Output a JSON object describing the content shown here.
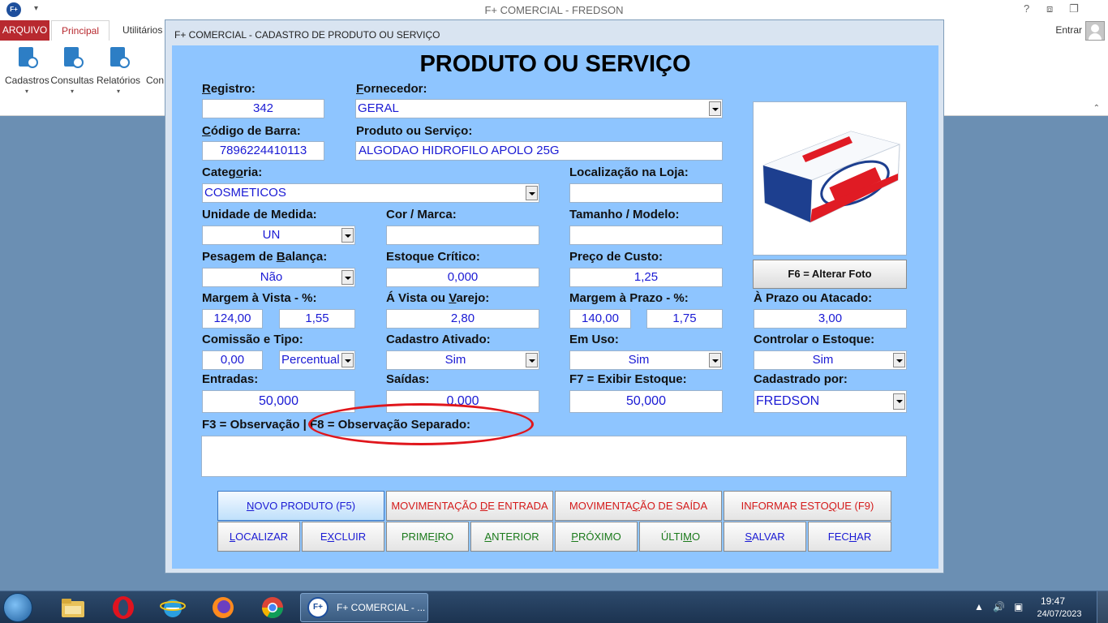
{
  "app": {
    "title": "F+ COMERCIAL - FREDSON",
    "logo": "F+",
    "help": "?",
    "signin": "Entrar"
  },
  "ribbon": {
    "tabs": [
      "ARQUIVO",
      "Principal",
      "Utilitários"
    ],
    "buttons": [
      "Cadastros",
      "Consultas",
      "Relatórios",
      "Con"
    ]
  },
  "dialog": {
    "title": "F+ COMERCIAL - CADASTRO DE PRODUTO OU SERVIÇO",
    "heading": "PRODUTO OU SERVIÇO",
    "photo_button": "F6 = Alterar Foto",
    "observation_label": "F3 = Observação | F8 = Observação Separado:",
    "fields": {
      "registro": {
        "label_u": "R",
        "label_rest": "egistro:",
        "value": "342"
      },
      "fornecedor": {
        "label_u": "F",
        "label_rest": "ornecedor:",
        "value": "GERAL"
      },
      "codigo_barra": {
        "label_u": "C",
        "label_rest": "ódigo de Barra:",
        "value": "7896224410113"
      },
      "produto": {
        "label": "Produto ou Serviço:",
        "value": "ALGODAO HIDROFILO APOLO 25G"
      },
      "categoria": {
        "label_pre": "Categ",
        "label_u": "o",
        "label_post": "ria:",
        "value": "COSMETICOS"
      },
      "localizacao": {
        "label": "Localização na Loja:",
        "value": ""
      },
      "unidade": {
        "label": "Unidade de Medida:",
        "value": "UN"
      },
      "cor_marca": {
        "label": "Cor / Marca:",
        "value": ""
      },
      "tamanho": {
        "label": "Tamanho / Modelo:",
        "value": ""
      },
      "pesagem": {
        "label_pre": "Pesagem de ",
        "label_u": "B",
        "label_post": "alança:",
        "value": "Não"
      },
      "estoque_critico": {
        "label": "Estoque Crítico:",
        "value": "0,000"
      },
      "preco_custo": {
        "label": "Preço de Custo:",
        "value": "1,25"
      },
      "margem_vista": {
        "label": "Margem à Vista - %:",
        "value1": "124,00",
        "value2": "1,55"
      },
      "avista": {
        "label_pre": "Á Vista ou ",
        "label_u": "V",
        "label_post": "arejo:",
        "value": "2,80"
      },
      "margem_prazo": {
        "label": "Margem à Prazo - %:",
        "value1": "140,00",
        "value2": "1,75"
      },
      "aprazo": {
        "label": "À Prazo ou Atacado:",
        "value": "3,00"
      },
      "comissao": {
        "label": "Comissão e Tipo:",
        "value": "0,00",
        "tipo": "Percentual"
      },
      "cadastro_ativado": {
        "label": "Cadastro Ativado:",
        "value": "Sim"
      },
      "em_uso": {
        "label": "Em Uso:",
        "value": "Sim"
      },
      "controlar_estoque": {
        "label": "Controlar o Estoque:",
        "value": "Sim"
      },
      "entradas": {
        "label": "Entradas:",
        "value": "50,000"
      },
      "saidas": {
        "label": "Saídas:",
        "value": "0,000"
      },
      "exibir_estoque": {
        "label": "F7 = Exibir Estoque:",
        "value": "50,000"
      },
      "cadastrado_por": {
        "label": "Cadastrado por:",
        "value": "FREDSON"
      }
    },
    "buttons_row1": [
      {
        "pre": "",
        "u": "N",
        "post": "OVO PRODUTO (F5)"
      },
      {
        "pre": "MOVIMENTAÇÃO ",
        "u": "D",
        "post": "E ENTRADA"
      },
      {
        "pre": "MOVIMENTA",
        "u": "Ç",
        "post": "ÃO DE SAÍDA"
      },
      {
        "pre": "INFORMAR ESTO",
        "u": "Q",
        "post": "UE (F9)"
      }
    ],
    "buttons_row2": [
      {
        "pre": "",
        "u": "L",
        "post": "OCALIZAR"
      },
      {
        "pre": "E",
        "u": "X",
        "post": "CLUIR"
      },
      {
        "pre": "PRIME",
        "u": "I",
        "post": "RO"
      },
      {
        "pre": "",
        "u": "A",
        "post": "NTERIOR"
      },
      {
        "pre": "",
        "u": "P",
        "post": "RÓXIMO"
      },
      {
        "pre": "ÚLTI",
        "u": "M",
        "post": "O"
      },
      {
        "pre": "",
        "u": "S",
        "post": "ALVAR"
      },
      {
        "pre": "FEC",
        "u": "H",
        "post": "AR"
      }
    ]
  },
  "taskbar": {
    "app_label": "F+ COMERCIAL - ...",
    "app_logo": "F+",
    "time": "19:47",
    "date": "24/07/2023"
  },
  "colors": {
    "form_bg": "#8ec5ff",
    "field_text": "#1a1ad4",
    "annotation": "#e0161c",
    "arquivo_tab": "#b8292f"
  }
}
